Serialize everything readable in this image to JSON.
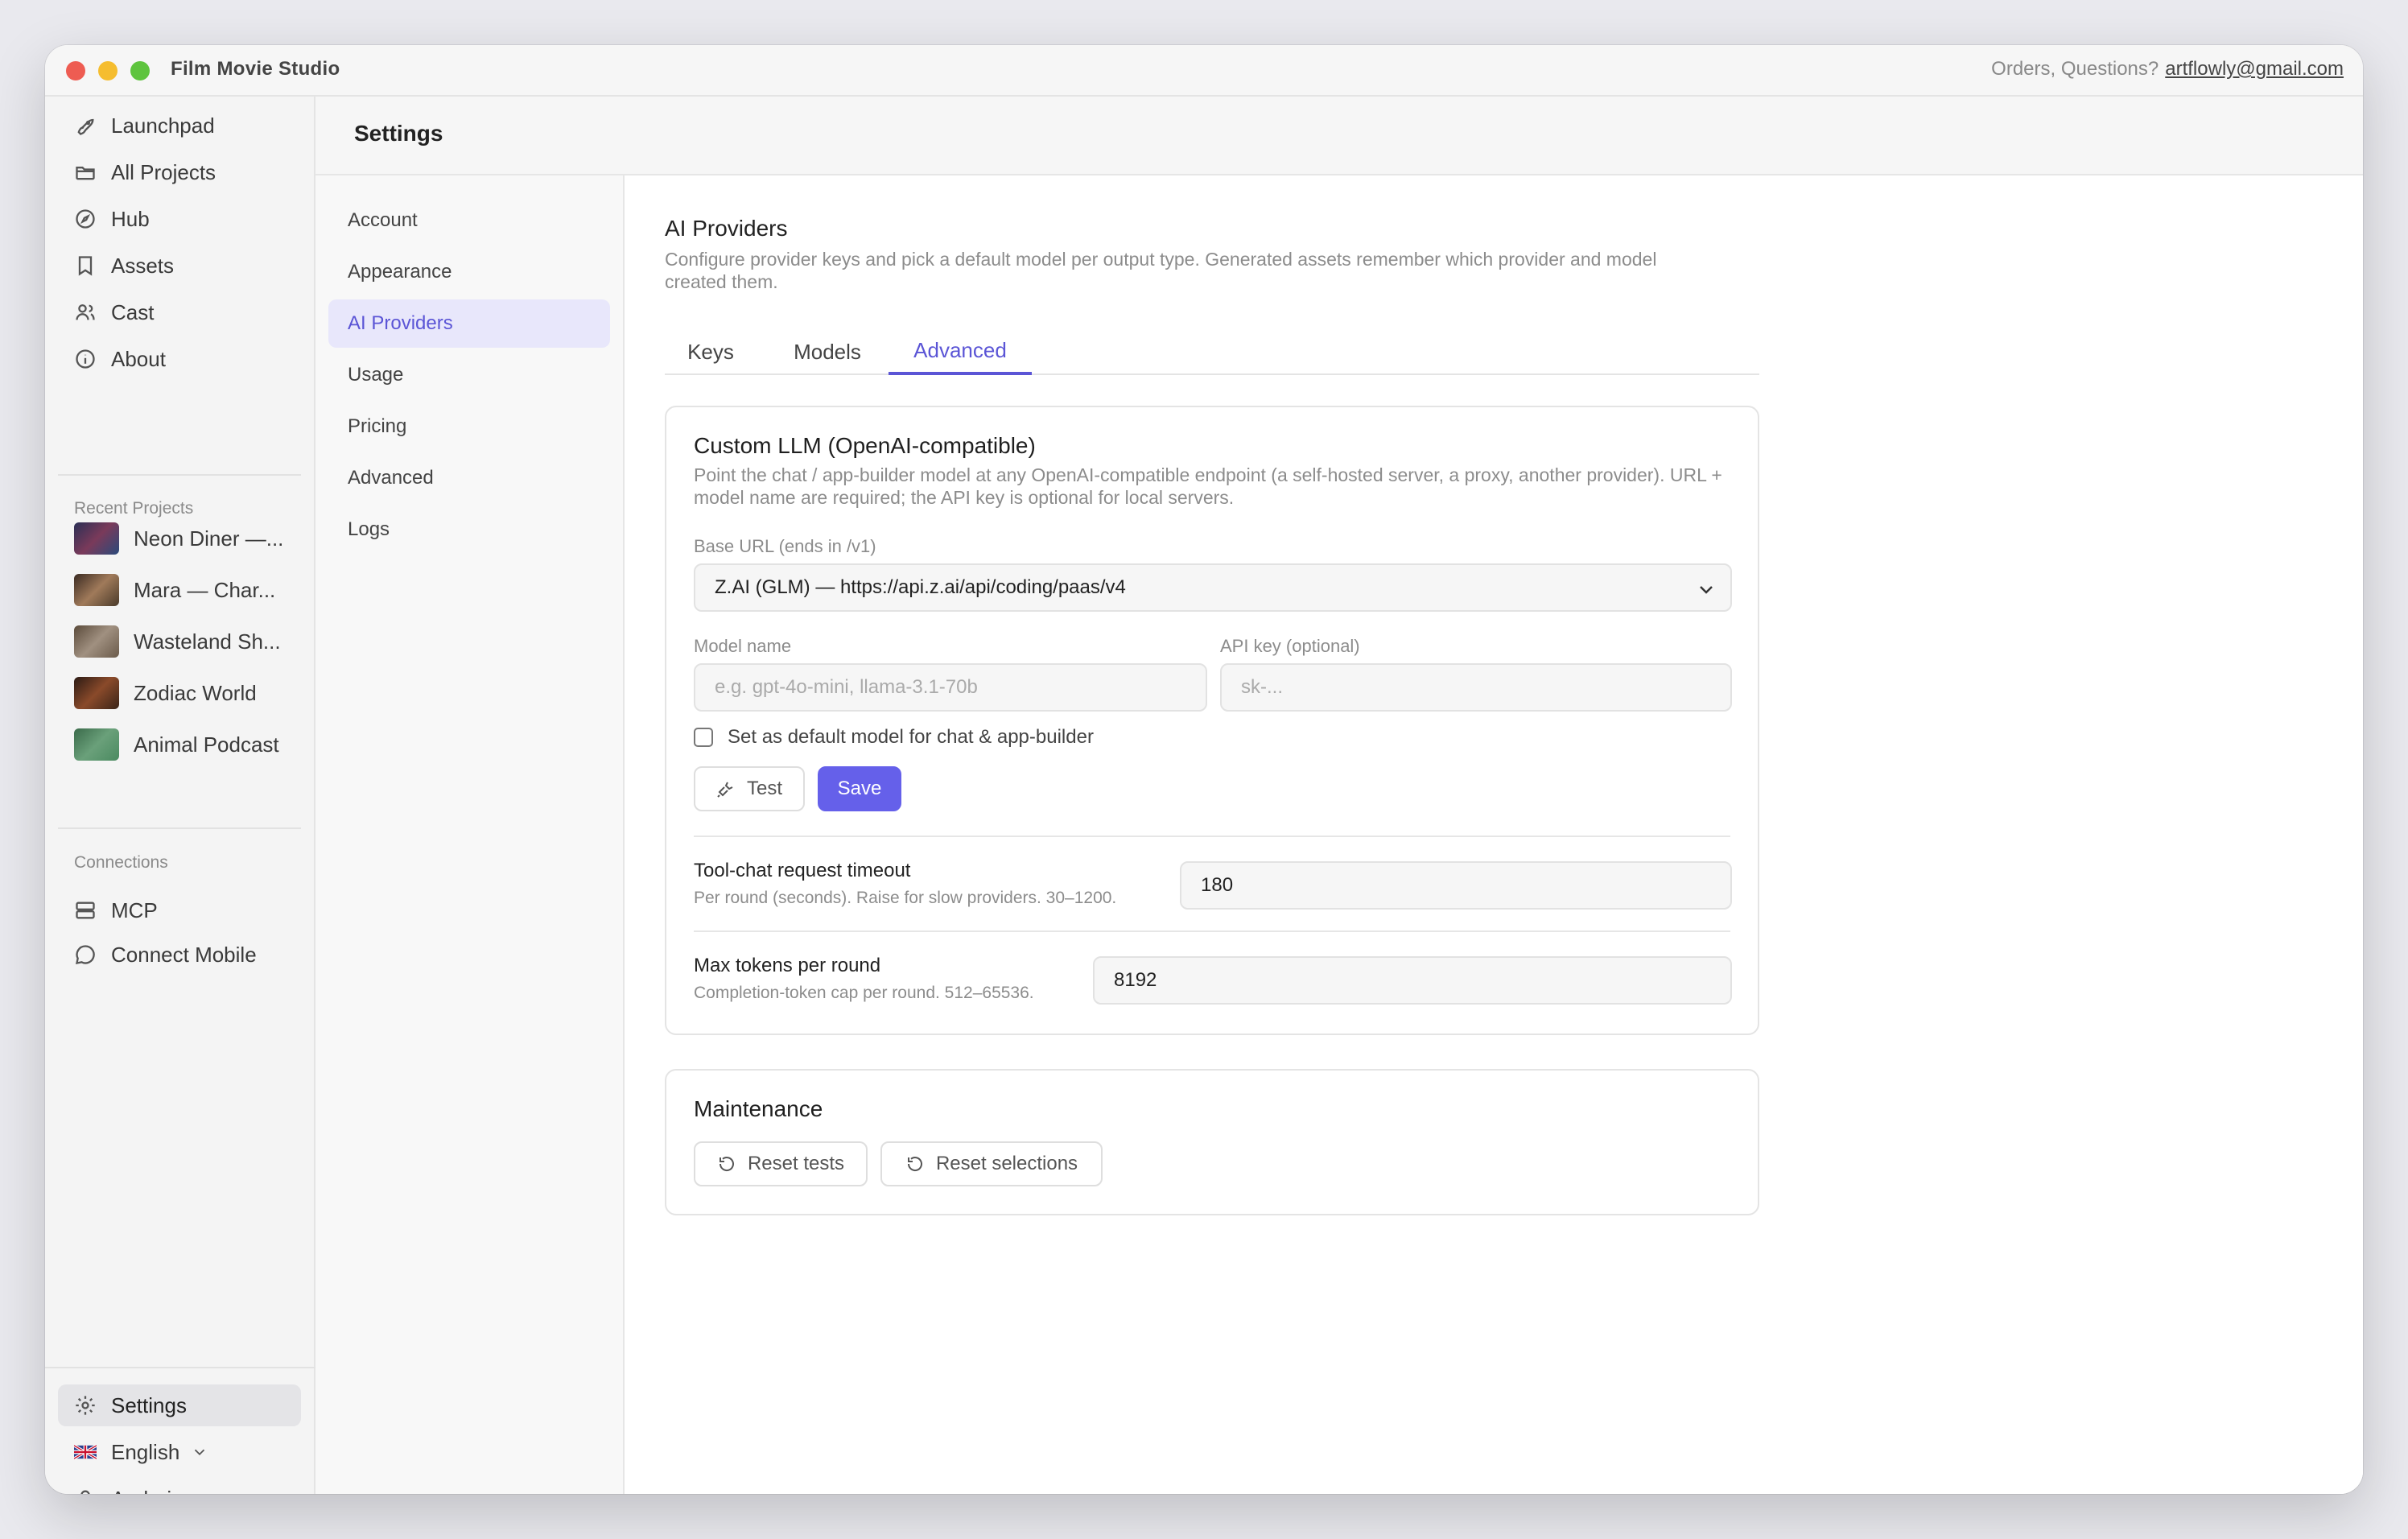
{
  "window": {
    "app_title": "Film Movie Studio",
    "contact_prefix": "Orders, Questions?",
    "contact_email": "artflowly@gmail.com"
  },
  "sidebar": {
    "items": [
      {
        "label": "Launchpad",
        "icon": "rocket-icon"
      },
      {
        "label": "All Projects",
        "icon": "folder-icon"
      },
      {
        "label": "Hub",
        "icon": "compass-icon"
      },
      {
        "label": "Assets",
        "icon": "bookmark-icon"
      },
      {
        "label": "Cast",
        "icon": "users-icon"
      },
      {
        "label": "About",
        "icon": "info-icon"
      }
    ],
    "recent_label": "Recent Projects",
    "recent": [
      {
        "label": "Neon Diner —...",
        "color": "#3b3f66"
      },
      {
        "label": "Mara — Char...",
        "color": "#6b4a3a"
      },
      {
        "label": "Wasteland Sh...",
        "color": "#7a6a5a"
      },
      {
        "label": "Zodiac World",
        "color": "#5a3426"
      },
      {
        "label": "Animal Podcast",
        "color": "#4a8a60"
      }
    ],
    "connections_label": "Connections",
    "connections": [
      {
        "label": "MCP",
        "icon": "server-icon"
      },
      {
        "label": "Connect Mobile",
        "icon": "chat-icon"
      }
    ],
    "bottom": {
      "settings": "Settings",
      "language": "English",
      "user": "Andrej"
    }
  },
  "main": {
    "title": "Settings"
  },
  "settings_nav": {
    "items": [
      "Account",
      "Appearance",
      "AI Providers",
      "Usage",
      "Pricing",
      "Advanced",
      "Logs"
    ],
    "active": "AI Providers"
  },
  "content": {
    "title": "AI Providers",
    "description": "Configure provider keys and pick a default model per output type. Generated assets remember which provider and model created them.",
    "tabs": [
      "Keys",
      "Models",
      "Advanced"
    ],
    "active_tab": "Advanced",
    "custom_llm": {
      "title": "Custom LLM (OpenAI-compatible)",
      "description": "Point the chat / app-builder model at any OpenAI-compatible endpoint (a self-hosted server, a proxy, another provider). URL + model name are required; the API key is optional for local servers.",
      "base_url_label": "Base URL (ends in /v1)",
      "base_url_value": "Z.AI (GLM) — https://api.z.ai/api/coding/paas/v4",
      "model_label": "Model name",
      "model_placeholder": "e.g. gpt-4o-mini, llama-3.1-70b",
      "api_key_label": "API key (optional)",
      "api_key_placeholder": "sk-...",
      "default_checkbox_label": "Set as default model for chat & app-builder",
      "test_label": "Test",
      "save_label": "Save",
      "timeout_title": "Tool-chat request timeout",
      "timeout_sub": "Per round (seconds). Raise for slow providers. 30–1200.",
      "timeout_value": "180",
      "max_tokens_title": "Max tokens per round",
      "max_tokens_sub": "Completion-token cap per round. 512–65536.",
      "max_tokens_value": "8192"
    },
    "maintenance": {
      "title": "Maintenance",
      "reset_tests": "Reset tests",
      "reset_selections": "Reset selections"
    }
  },
  "colors": {
    "accent": "#6560ea",
    "accent_light": "#e8e7fb"
  }
}
